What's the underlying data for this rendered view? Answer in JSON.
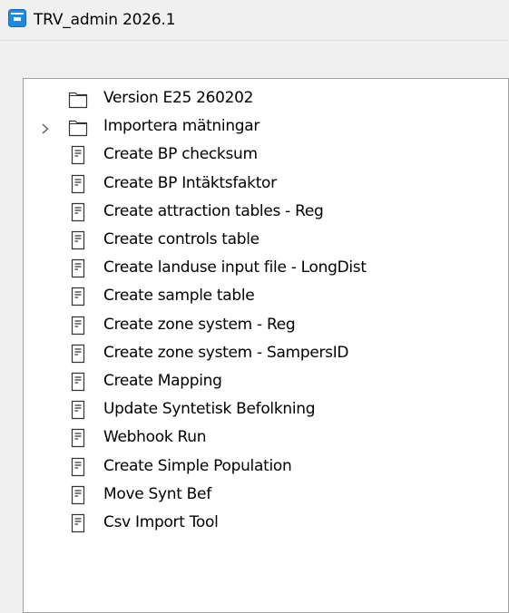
{
  "window": {
    "title": "TRV_admin 2026.1"
  },
  "tree": {
    "items": [
      {
        "label": "Version E25 260202",
        "type": "folder",
        "expandable": false
      },
      {
        "label": "Importera mätningar",
        "type": "folder",
        "expandable": true
      },
      {
        "label": "Create BP checksum",
        "type": "script"
      },
      {
        "label": "Create BP Intäktsfaktor",
        "type": "script"
      },
      {
        "label": "Create attraction tables - Reg",
        "type": "script"
      },
      {
        "label": "Create controls table",
        "type": "script"
      },
      {
        "label": "Create landuse input file - LongDist",
        "type": "script"
      },
      {
        "label": "Create sample table",
        "type": "script"
      },
      {
        "label": "Create zone system - Reg",
        "type": "script"
      },
      {
        "label": "Create zone system - SampersID",
        "type": "script"
      },
      {
        "label": "Create Mapping",
        "type": "script"
      },
      {
        "label": "Update Syntetisk Befolkning",
        "type": "script"
      },
      {
        "label": "Webhook Run",
        "type": "script"
      },
      {
        "label": "Create Simple Population",
        "type": "script"
      },
      {
        "label": "Move Synt Bef",
        "type": "script"
      },
      {
        "label": "Csv Import Tool",
        "type": "script"
      }
    ]
  },
  "icons": {
    "app": "app-window-icon",
    "folder": "folder-icon",
    "script": "script-document-icon",
    "expander": "chevron-right-icon"
  },
  "colors": {
    "app_icon": "#1e88e5",
    "background": "#f0f0f0",
    "panel": "#ffffff",
    "border": "#a0a0a0"
  }
}
